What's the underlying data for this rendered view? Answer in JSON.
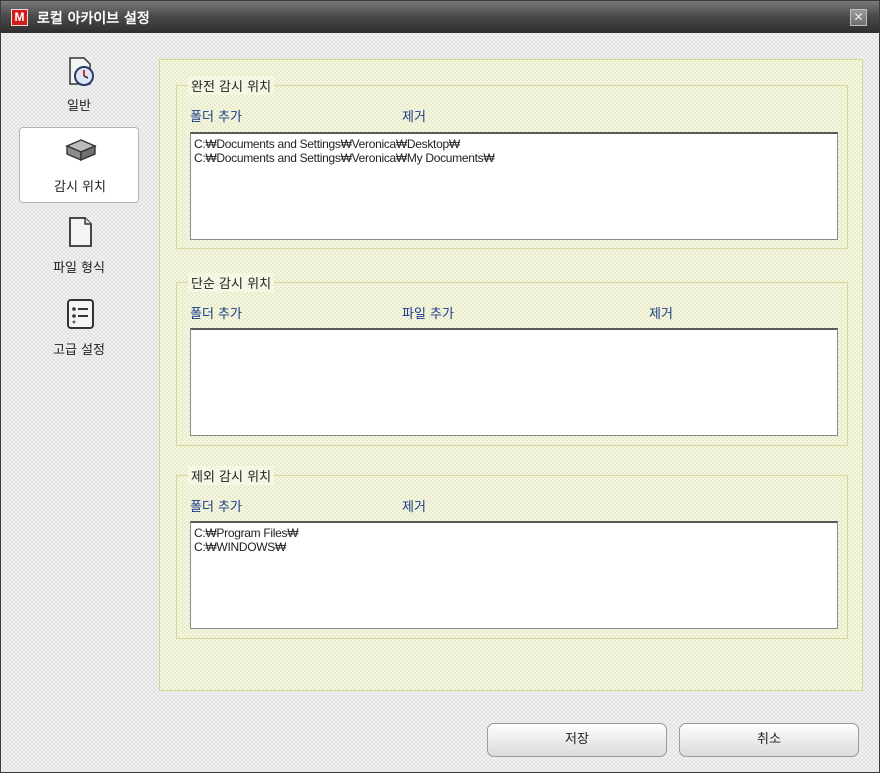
{
  "window": {
    "title": "로컬 아카이브 설정",
    "app_icon_letter": "M",
    "close_symbol": "✕"
  },
  "sidebar": {
    "items": [
      {
        "label": "일반",
        "icon": "clock-document-icon",
        "selected": false
      },
      {
        "label": "감시 위치",
        "icon": "hard-drive-icon",
        "selected": true
      },
      {
        "label": "파일 형식",
        "icon": "document-icon",
        "selected": false
      },
      {
        "label": "고급 설정",
        "icon": "checklist-icon",
        "selected": false
      }
    ]
  },
  "sections": {
    "full_watch": {
      "title": "완전 감시 위치",
      "add_folder": "폴더 추가",
      "remove": "제거",
      "items": [
        "C:₩Documents and Settings₩Veronica₩Desktop₩",
        "C:₩Documents and Settings₩Veronica₩My Documents₩"
      ]
    },
    "simple_watch": {
      "title": "단순 감시 위치",
      "add_folder": "폴더 추가",
      "add_file": "파일 추가",
      "remove": "제거",
      "items": []
    },
    "exclude_watch": {
      "title": "제외 감시 위치",
      "add_folder": "폴더 추가",
      "remove": "제거",
      "items": [
        "C:₩Program Files₩",
        "C:₩WINDOWS₩"
      ]
    }
  },
  "buttons": {
    "save": "저장",
    "cancel": "취소"
  },
  "colors": {
    "link": "#1a3a8a",
    "app_icon": "#d21d1d",
    "panel_border": "#cfd98e"
  }
}
